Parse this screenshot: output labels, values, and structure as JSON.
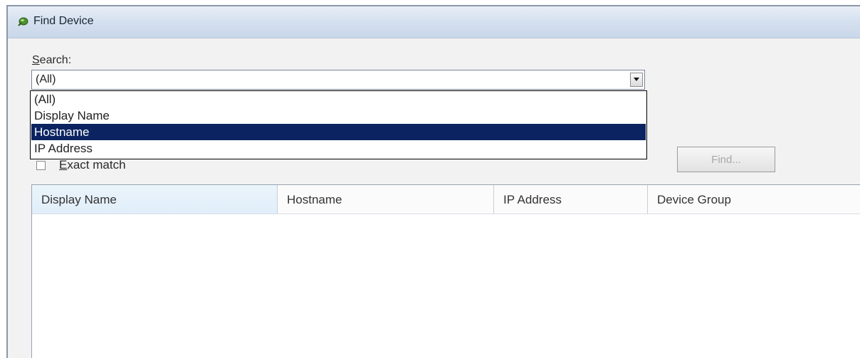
{
  "window": {
    "title": "Find Device"
  },
  "search": {
    "label_accel": "S",
    "label_rest": "earch:",
    "selected_value": "(All)",
    "options": [
      "(All)",
      "Display Name",
      "Hostname",
      "IP Address"
    ],
    "highlighted_option": "Hostname"
  },
  "exact_match": {
    "label_accel": "E",
    "label_rest": "xact match",
    "checked": false
  },
  "find_button": {
    "label": "Find...",
    "enabled": false
  },
  "results_table": {
    "columns": [
      "Display Name",
      "Hostname",
      "IP Address",
      "Device Group"
    ],
    "rows": []
  },
  "colors": {
    "selection": "#0b2461",
    "titlebar": "#d6e1ef"
  }
}
